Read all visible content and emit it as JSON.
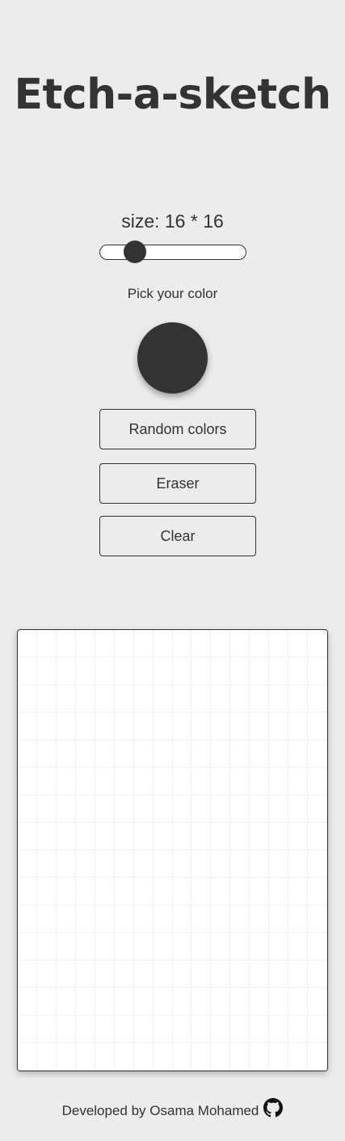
{
  "header": {
    "title": "Etch-a-sketch"
  },
  "controls": {
    "size_label": "size: 16 * 16",
    "size_value": 16,
    "size_min": 1,
    "size_max": 64,
    "pick_color_label": "Pick your color",
    "selected_color": "#333333",
    "random_colors_label": "Random colors",
    "eraser_label": "Eraser",
    "clear_label": "Clear"
  },
  "board": {
    "columns": 16,
    "rows": 16,
    "background_color": "#ffffff",
    "gridline_color": "#f1f1f1"
  },
  "footer": {
    "credit_text": "Developed by Osama Mohamed",
    "icon": "github-icon"
  },
  "colors": {
    "page_background": "#ececec",
    "text": "#333333",
    "accent": "#333333"
  }
}
